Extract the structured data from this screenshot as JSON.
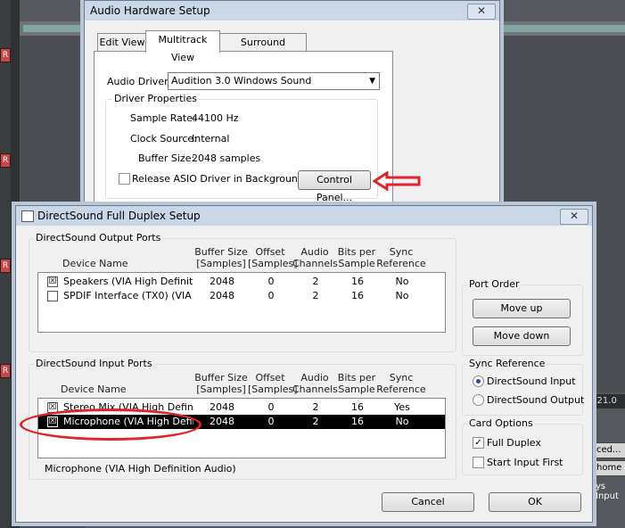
{
  "background": {
    "r_label": "R",
    "ruler_text": "0      21.0",
    "btn1": "ced...",
    "btn2": "home",
    "text": "ys Input"
  },
  "audio_setup": {
    "title": "Audio Hardware Setup",
    "close_glyph": "✕",
    "tabs": [
      "Edit View",
      "Multitrack View",
      "Surround Encoder"
    ],
    "audio_driver_label": "Audio Driver:",
    "audio_driver_value": "Audition 3.0 Windows Sound",
    "driver_properties_label": "Driver Properties",
    "sample_rate_label": "Sample Rate:",
    "sample_rate_value": "44100 Hz",
    "clock_source_label": "Clock Source:",
    "clock_source_value": "Internal",
    "buffer_size_label": "Buffer Size:",
    "buffer_size_value": "2048 samples",
    "release_asio_label": "Release ASIO Driver in Background",
    "release_asio_checked": false,
    "control_panel_button": "Control Panel..."
  },
  "ds_setup": {
    "title": "DirectSound Full Duplex Setup",
    "close_glyph": "✕",
    "output_group_label": "DirectSound Output Ports",
    "input_group_label": "DirectSound Input Ports",
    "columns": {
      "device": "Device Name",
      "buffer": "Buffer Size\n[Samples]",
      "offset": "Offset\n[Samples]",
      "channels": "Audio\nChannels",
      "bits": "Bits per\nSample",
      "sync": "Sync\nReference"
    },
    "output_rows": [
      {
        "checked": true,
        "name": "Speakers (VIA High Definiti...",
        "buffer": "2048",
        "offset": "0",
        "channels": "2",
        "bits": "16",
        "sync": "No"
      },
      {
        "checked": false,
        "name": "SPDIF Interface (TX0) (VIA ...",
        "buffer": "2048",
        "offset": "0",
        "channels": "2",
        "bits": "16",
        "sync": "No"
      }
    ],
    "input_rows": [
      {
        "checked": true,
        "name": "Stereo Mix (VIA High Definiti...",
        "buffer": "2048",
        "offset": "0",
        "channels": "2",
        "bits": "16",
        "sync": "Yes",
        "selected": false
      },
      {
        "checked": true,
        "name": "Microphone (VIA High Defini...",
        "buffer": "2048",
        "offset": "0",
        "channels": "2",
        "bits": "16",
        "sync": "No",
        "selected": true
      }
    ],
    "selected_device_full": "Microphone (VIA High Definition Audio)",
    "port_order_label": "Port Order",
    "move_up_button": "Move up",
    "move_down_button": "Move down",
    "sync_reference_label": "Sync Reference",
    "sync_options": [
      "DirectSound Input",
      "DirectSound Output"
    ],
    "sync_selected": "DirectSound Input",
    "card_options_label": "Card Options",
    "full_duplex_label": "Full Duplex",
    "full_duplex_checked": true,
    "start_input_first_label": "Start Input First",
    "start_input_first_checked": false,
    "cancel_button": "Cancel",
    "ok_button": "OK"
  },
  "annotation_colors": {
    "arrow": "#e0242a",
    "ellipse": "#e0242a"
  }
}
